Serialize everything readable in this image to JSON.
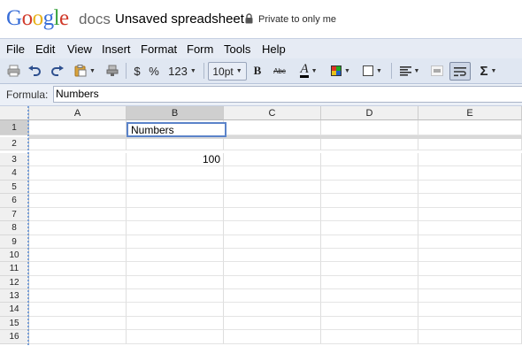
{
  "header": {
    "logo_letters": [
      {
        "ch": "G",
        "color": "#3a6fd8"
      },
      {
        "ch": "o",
        "color": "#d13a2a"
      },
      {
        "ch": "o",
        "color": "#e8b21a"
      },
      {
        "ch": "g",
        "color": "#3a6fd8"
      },
      {
        "ch": "l",
        "color": "#3aa33f"
      },
      {
        "ch": "e",
        "color": "#d13a2a"
      }
    ],
    "product": "docs",
    "doc_title": "Unsaved spreadsheet",
    "privacy": "Private to only me"
  },
  "menu": [
    "File",
    "Edit",
    "View",
    "Insert",
    "Format",
    "Form",
    "Tools",
    "Help"
  ],
  "toolbar": {
    "currency": "$",
    "percent": "%",
    "number_format": "123",
    "font_size": "10pt",
    "bold": "B",
    "strike": "Abc",
    "text_color": "A",
    "sum": "Σ",
    "icons": [
      "print-icon",
      "undo-icon",
      "redo-icon",
      "paste-icon",
      "paint-format-icon",
      "fill-color-icon",
      "borders-icon",
      "align-icon",
      "merge-icon",
      "wrap-text-icon",
      "sum-icon"
    ]
  },
  "formula": {
    "label": "Formula:",
    "value": "Numbers"
  },
  "grid": {
    "columns": [
      "A",
      "B",
      "C",
      "D",
      "E"
    ],
    "active_column": "B",
    "rows": [
      "1",
      "2",
      "3",
      "4",
      "5",
      "6",
      "7",
      "8",
      "9",
      "10",
      "11",
      "12",
      "13",
      "14",
      "15",
      "16"
    ],
    "active_row": "1",
    "cells": {
      "B1": "Numbers",
      "B3": "100"
    }
  },
  "colors": {
    "menubar_bg": "#e6ebf4",
    "toolbar_bg": "#e0e7f2",
    "selection_border": "#5b83c9"
  }
}
